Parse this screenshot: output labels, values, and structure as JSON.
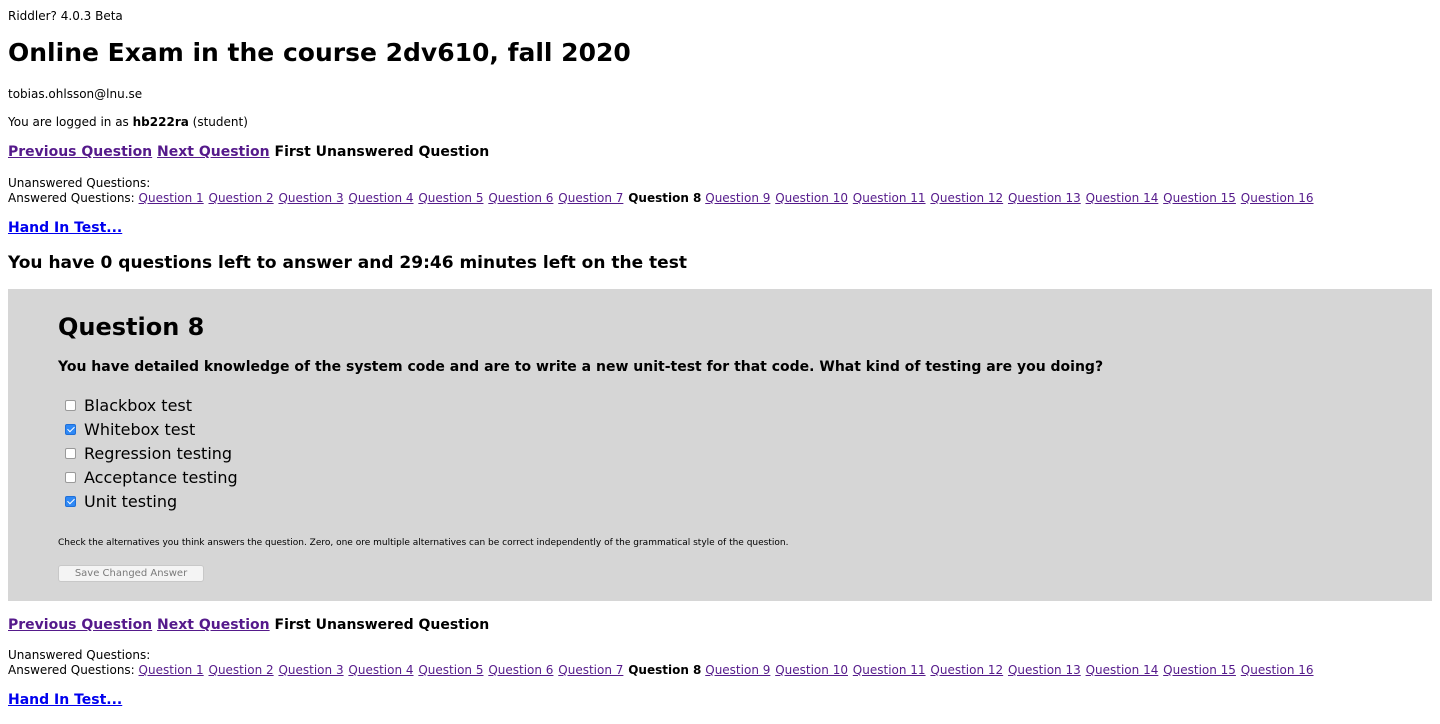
{
  "app": {
    "version": "Riddler? 4.0.3 Beta"
  },
  "page": {
    "title": "Online Exam in the course 2dv610, fall 2020",
    "email": "tobias.ohlsson@lnu.se",
    "login_prefix": "You are logged in as",
    "username": "hb222ra",
    "role": "(student)"
  },
  "nav": {
    "previous": "Previous Question",
    "next": "Next Question",
    "first_unanswered": "First Unanswered Question"
  },
  "question_list": {
    "unanswered_label": "Unanswered Questions:",
    "answered_label": "Answered Questions:",
    "current": "Question 8",
    "before_current": [
      "Question 1",
      "Question 2",
      "Question 3",
      "Question 4",
      "Question 5",
      "Question 6",
      "Question 7"
    ],
    "after_current": [
      "Question 9",
      "Question 10",
      "Question 11",
      "Question 12",
      "Question 13",
      "Question 14",
      "Question 15",
      "Question 16"
    ]
  },
  "hand_in": "Hand In Test...",
  "status": "You have 0 questions left to answer and 29:46 minutes left on the test",
  "question": {
    "title": "Question 8",
    "text": "You have detailed knowledge of the system code and are to write a new unit-test for that code. What kind of testing are you doing?",
    "options": [
      {
        "label": "Blackbox test",
        "checked": false
      },
      {
        "label": "Whitebox test",
        "checked": true
      },
      {
        "label": "Regression testing",
        "checked": false
      },
      {
        "label": "Acceptance testing",
        "checked": false
      },
      {
        "label": "Unit testing",
        "checked": true
      }
    ],
    "hint": "Check the alternatives you think answers the question. Zero, one ore multiple alternatives can be correct independently of the grammatical style of the question.",
    "save_label": "Save Changed Answer"
  },
  "colors": {
    "panel": "#d6d6d6",
    "visited_link": "#551a8b",
    "link": "#0000ee",
    "checkbox_checked": "#2e88f5"
  }
}
